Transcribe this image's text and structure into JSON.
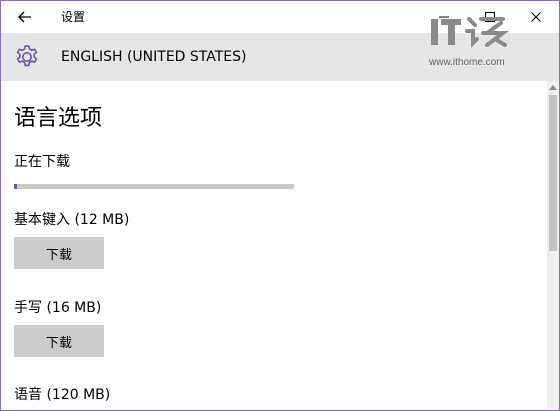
{
  "window": {
    "title": "设置",
    "controls": {
      "minimize_icon": "minimize-icon",
      "maximize_icon": "maximize-icon",
      "close_icon": "close-icon"
    }
  },
  "header": {
    "icon": "gear-icon",
    "title": "ENGLISH (UNITED STATES)"
  },
  "watermark": {
    "logo_text": "IT之家",
    "url": "www.ithome.com"
  },
  "page": {
    "title": "语言选项",
    "downloading_label": "正在下载",
    "download_progress": 0.01,
    "features": [
      {
        "label": "基本键入 (12 MB)",
        "button": "下载"
      },
      {
        "label": "手写 (16 MB)",
        "button": "下载"
      },
      {
        "label": "语音 (120 MB)"
      }
    ]
  },
  "colors": {
    "accent": "#6b57a8",
    "header_band": "#e6e6e6",
    "button_bg": "#cccccc",
    "progress_track": "#c9c9c9",
    "window_border": "#8a6fb0"
  }
}
